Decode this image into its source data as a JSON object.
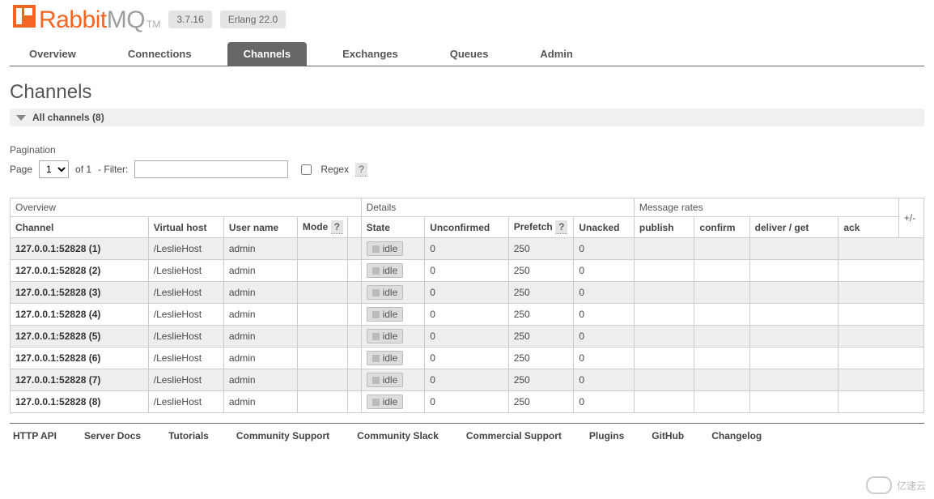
{
  "header": {
    "brand_left": "Rabbit",
    "brand_right": "MQ",
    "tm": "TM",
    "version": "3.7.16",
    "erlang": "Erlang 22.0"
  },
  "nav": {
    "items": [
      "Overview",
      "Connections",
      "Channels",
      "Exchanges",
      "Queues",
      "Admin"
    ],
    "active": "Channels"
  },
  "page": {
    "title": "Channels",
    "section_label": "All channels (8)"
  },
  "pagination": {
    "label": "Pagination",
    "page_word": "Page",
    "page_current": "1",
    "of_word": "of 1",
    "filter_label": "- Filter:",
    "filter_value": "",
    "regex_label": "Regex",
    "help": "?"
  },
  "table": {
    "groups": {
      "overview": "Overview",
      "details": "Details",
      "rates": "Message rates",
      "plus_minus": "+/-"
    },
    "cols": {
      "channel": "Channel",
      "vhost": "Virtual host",
      "user": "User name",
      "mode": "Mode",
      "mode_help": "?",
      "state": "State",
      "unconfirmed": "Unconfirmed",
      "prefetch": "Prefetch",
      "prefetch_help": "?",
      "unacked": "Unacked",
      "publish": "publish",
      "confirm": "confirm",
      "deliver": "deliver / get",
      "ack": "ack"
    },
    "rows": [
      {
        "channel": "127.0.0.1:52828 (1)",
        "vhost": "/LeslieHost",
        "user": "admin",
        "mode": "",
        "state": "idle",
        "unconfirmed": "0",
        "prefetch": "250",
        "unacked": "0"
      },
      {
        "channel": "127.0.0.1:52828 (2)",
        "vhost": "/LeslieHost",
        "user": "admin",
        "mode": "",
        "state": "idle",
        "unconfirmed": "0",
        "prefetch": "250",
        "unacked": "0"
      },
      {
        "channel": "127.0.0.1:52828 (3)",
        "vhost": "/LeslieHost",
        "user": "admin",
        "mode": "",
        "state": "idle",
        "unconfirmed": "0",
        "prefetch": "250",
        "unacked": "0"
      },
      {
        "channel": "127.0.0.1:52828 (4)",
        "vhost": "/LeslieHost",
        "user": "admin",
        "mode": "",
        "state": "idle",
        "unconfirmed": "0",
        "prefetch": "250",
        "unacked": "0"
      },
      {
        "channel": "127.0.0.1:52828 (5)",
        "vhost": "/LeslieHost",
        "user": "admin",
        "mode": "",
        "state": "idle",
        "unconfirmed": "0",
        "prefetch": "250",
        "unacked": "0"
      },
      {
        "channel": "127.0.0.1:52828 (6)",
        "vhost": "/LeslieHost",
        "user": "admin",
        "mode": "",
        "state": "idle",
        "unconfirmed": "0",
        "prefetch": "250",
        "unacked": "0"
      },
      {
        "channel": "127.0.0.1:52828 (7)",
        "vhost": "/LeslieHost",
        "user": "admin",
        "mode": "",
        "state": "idle",
        "unconfirmed": "0",
        "prefetch": "250",
        "unacked": "0"
      },
      {
        "channel": "127.0.0.1:52828 (8)",
        "vhost": "/LeslieHost",
        "user": "admin",
        "mode": "",
        "state": "idle",
        "unconfirmed": "0",
        "prefetch": "250",
        "unacked": "0"
      }
    ]
  },
  "footer": {
    "links": [
      "HTTP API",
      "Server Docs",
      "Tutorials",
      "Community Support",
      "Community Slack",
      "Commercial Support",
      "Plugins",
      "GitHub",
      "Changelog"
    ]
  },
  "watermark": "亿速云"
}
